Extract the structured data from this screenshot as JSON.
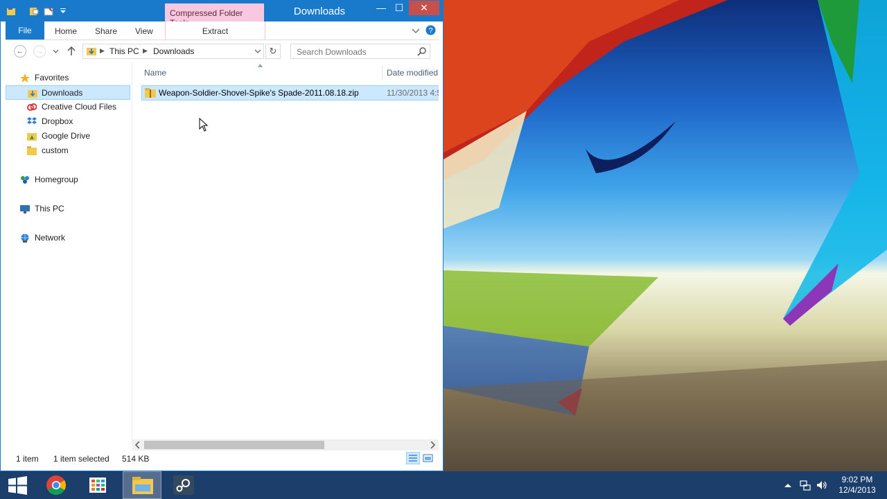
{
  "window": {
    "title": "Downloads",
    "context_tab_group": "Compressed Folder Tools",
    "minimize_glyph": "—",
    "maximize_glyph": "☐",
    "close_glyph": "✕"
  },
  "ribbon": {
    "tabs": [
      {
        "label": "File"
      },
      {
        "label": "Home"
      },
      {
        "label": "Share"
      },
      {
        "label": "View"
      },
      {
        "label": "Extract"
      }
    ]
  },
  "address": {
    "breadcrumb": [
      "This PC",
      "Downloads"
    ],
    "search_placeholder": "Search Downloads"
  },
  "navpane": {
    "items": [
      {
        "label": "Favorites",
        "icon": "star-icon"
      },
      {
        "label": "Downloads",
        "icon": "downloads-folder-icon",
        "selected": true
      },
      {
        "label": "Creative Cloud Files",
        "icon": "creative-cloud-icon"
      },
      {
        "label": "Dropbox",
        "icon": "dropbox-icon"
      },
      {
        "label": "Google Drive",
        "icon": "google-drive-icon"
      },
      {
        "label": "custom",
        "icon": "folder-icon"
      },
      {
        "label": "Homegroup",
        "icon": "homegroup-icon"
      },
      {
        "label": "This PC",
        "icon": "computer-icon"
      },
      {
        "label": "Network",
        "icon": "network-icon"
      }
    ]
  },
  "filelist": {
    "columns": [
      "Name",
      "Date modified"
    ],
    "rows": [
      {
        "name": "Weapon-Soldier-Shovel-Spike's Spade-2011.08.18.zip",
        "date_modified": "11/30/2013 4:5",
        "selected": true
      }
    ]
  },
  "status": {
    "item_count": "1 item",
    "selection": "1 item selected",
    "size": "514 KB"
  },
  "taskbar": {
    "apps": [
      "start-icon",
      "chrome-icon",
      "store-icon",
      "file-explorer-icon",
      "steam-icon"
    ],
    "time": "9:02 PM",
    "date": "12/4/2013"
  },
  "colors": {
    "title_blue": "#1979ca",
    "context_pink": "#f9c7df",
    "selection": "#cce8ff",
    "close_red": "#c7504b",
    "taskbar": "#1c3e6b"
  }
}
